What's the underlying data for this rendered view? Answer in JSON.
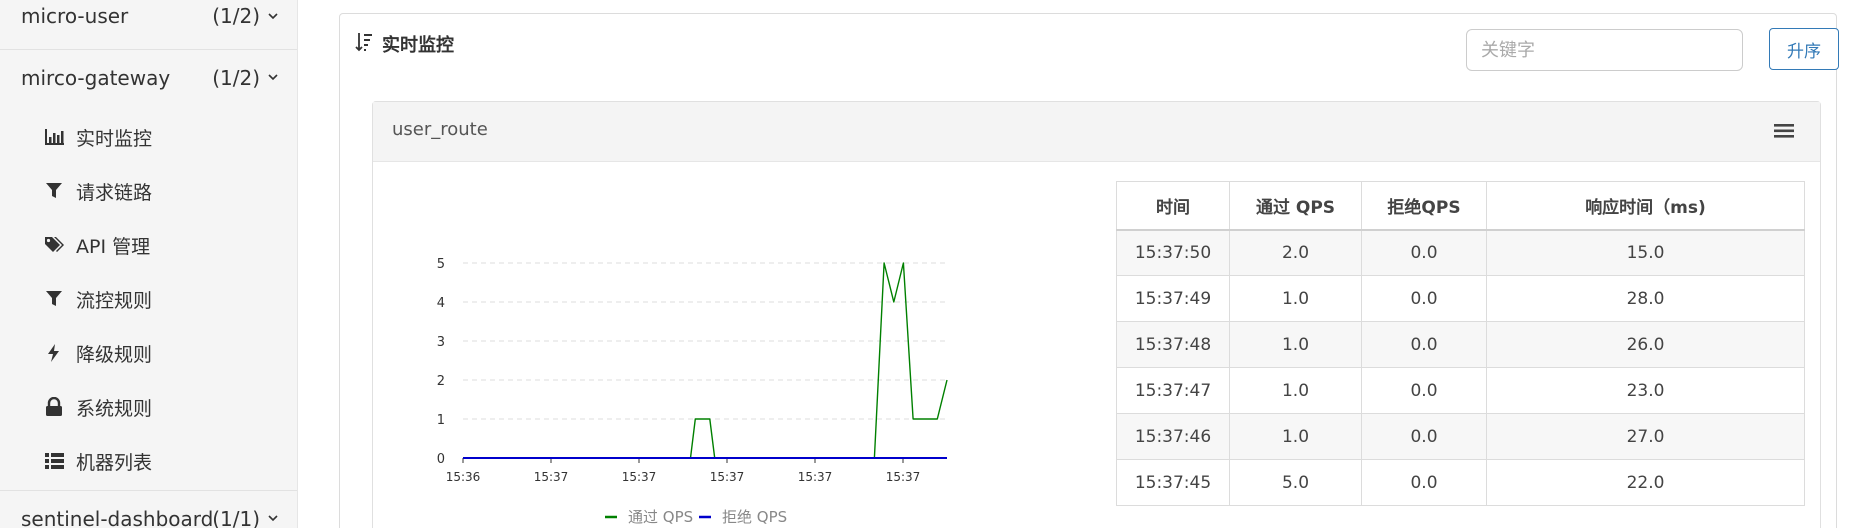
{
  "sidebar": {
    "apps": [
      {
        "name": "micro-user",
        "count": "(1/2)"
      },
      {
        "name": "mirco-gateway",
        "count": "(1/2)"
      },
      {
        "name": "sentinel-dashboard",
        "count": "(1/1)"
      }
    ],
    "menu": [
      {
        "label": "实时监控",
        "icon": "bar-chart-icon"
      },
      {
        "label": "请求链路",
        "icon": "filter-icon"
      },
      {
        "label": "API 管理",
        "icon": "tags-icon"
      },
      {
        "label": "流控规则",
        "icon": "filter-icon"
      },
      {
        "label": "降级规则",
        "icon": "bolt-icon"
      },
      {
        "label": "系统规则",
        "icon": "lock-icon"
      },
      {
        "label": "机器列表",
        "icon": "list-icon"
      }
    ]
  },
  "main": {
    "title": "实时监控",
    "search_placeholder": "关键字",
    "sort_label": "升序",
    "card": {
      "title": "user_route",
      "table": {
        "headers": [
          "时间",
          "通过 QPS",
          "拒绝QPS",
          "响应时间（ms)"
        ],
        "rows": [
          [
            "15:37:50",
            "2.0",
            "0.0",
            "15.0"
          ],
          [
            "15:37:49",
            "1.0",
            "0.0",
            "28.0"
          ],
          [
            "15:37:48",
            "1.0",
            "0.0",
            "26.0"
          ],
          [
            "15:37:47",
            "1.0",
            "0.0",
            "23.0"
          ],
          [
            "15:37:46",
            "1.0",
            "0.0",
            "27.0"
          ],
          [
            "15:37:45",
            "5.0",
            "0.0",
            "22.0"
          ]
        ]
      }
    }
  },
  "chart_data": {
    "type": "line",
    "x_ticks": [
      "15:36",
      "15:37",
      "15:37",
      "15:37",
      "15:37",
      "15:37"
    ],
    "ylim": [
      0,
      5
    ],
    "y_ticks": [
      0,
      1,
      2,
      3,
      4,
      5
    ],
    "grid": true,
    "legend_position": "bottom",
    "series": [
      {
        "name": "通过 QPS",
        "color": "#008000",
        "points": [
          [
            0,
            0
          ],
          [
            0.47,
            0
          ],
          [
            0.48,
            1
          ],
          [
            0.51,
            1
          ],
          [
            0.52,
            0
          ],
          [
            0.85,
            0
          ],
          [
            0.87,
            5
          ],
          [
            0.89,
            4
          ],
          [
            0.91,
            5
          ],
          [
            0.93,
            1
          ],
          [
            0.98,
            1
          ],
          [
            1.0,
            2
          ]
        ]
      },
      {
        "name": "拒绝 QPS",
        "color": "#0000cc",
        "points": [
          [
            0,
            0
          ],
          [
            1.0,
            0
          ]
        ]
      }
    ]
  }
}
